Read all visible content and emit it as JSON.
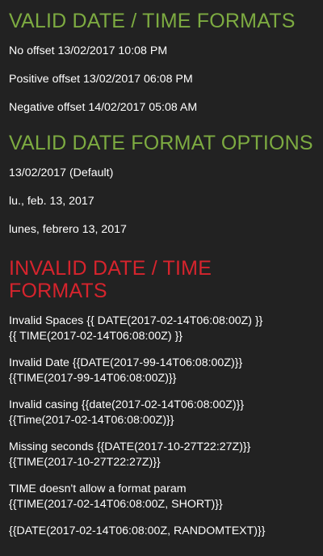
{
  "sections": [
    {
      "title": "VALID DATE / TIME FORMATS",
      "items": [
        "No offset 13/02/2017 10:08 PM",
        "Positive offset 13/02/2017 06:08 PM",
        "Negative offset 14/02/2017 05:08 AM"
      ]
    },
    {
      "title": "VALID DATE FORMAT OPTIONS",
      "items": [
        "13/02/2017 (Default)",
        "lu., feb. 13, 2017",
        "lunes, febrero 13, 2017"
      ]
    },
    {
      "title": "INVALID DATE / TIME FORMATS",
      "items": [
        {
          "line1": "Invalid Spaces {{ DATE(2017-02-14T06:08:00Z) }}",
          "line2": "{{ TIME(2017-02-14T06:08:00Z) }}"
        },
        {
          "line1": "Invalid Date {{DATE(2017-99-14T06:08:00Z)}}",
          "line2": "{{TIME(2017-99-14T06:08:00Z)}}"
        },
        {
          "line1": "Invalid casing {{date(2017-02-14T06:08:00Z)}}",
          "line2": "{{Time(2017-02-14T06:08:00Z)}}"
        },
        {
          "line1": "Missing seconds {{DATE(2017-10-27T22:27Z)}}",
          "line2": "{{TIME(2017-10-27T22:27Z)}}"
        },
        {
          "line1": "TIME doesn't allow a format param",
          "line2": "{{TIME(2017-02-14T06:08:00Z, SHORT)}}"
        },
        {
          "line1": "{{DATE(2017-02-14T06:08:00Z, RANDOMTEXT)}}"
        }
      ]
    }
  ],
  "colors": {
    "background": "#222222",
    "valid_heading": "#7dab41",
    "invalid_heading": "#d6242d",
    "text": "#ffffff"
  }
}
